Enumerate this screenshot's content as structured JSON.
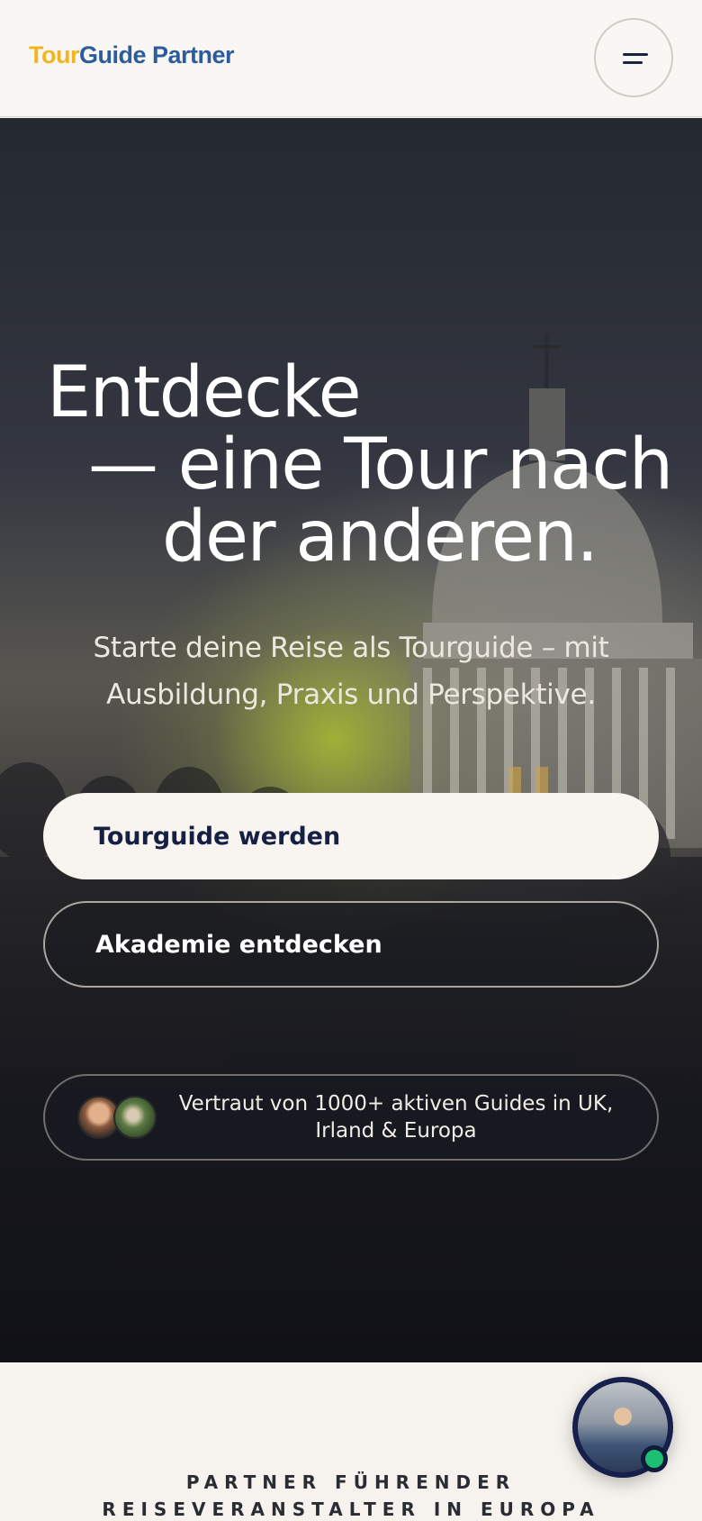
{
  "header": {
    "logo": {
      "part1": "Tour",
      "part2": "Guide",
      "part3": " Partner"
    },
    "menu_icon": "hamburger-icon"
  },
  "hero": {
    "title_line1": "Entdecke",
    "title_line2": "— eine Tour nach",
    "title_line3": "der anderen.",
    "subtitle": "Starte deine Reise als Tourguide – mit Ausbildung, Praxis und Perspektive.",
    "primary_button": "Tourguide werden",
    "secondary_button": "Akademie entdecken",
    "trust_text": "Vertraut von 1000+ aktiven Guides in UK, Irland & Europa"
  },
  "partners": {
    "heading": "PARTNER FÜHRENDER REISEVERANSTALTER IN EUROPA"
  },
  "chat": {
    "icon": "chat-avatar-icon",
    "status": "online"
  },
  "colors": {
    "logo_yellow": "#f2b51f",
    "logo_blue": "#2d5c9c",
    "navy": "#152044",
    "online_green": "#1dbf73",
    "page_bg": "#f6f3ee"
  }
}
